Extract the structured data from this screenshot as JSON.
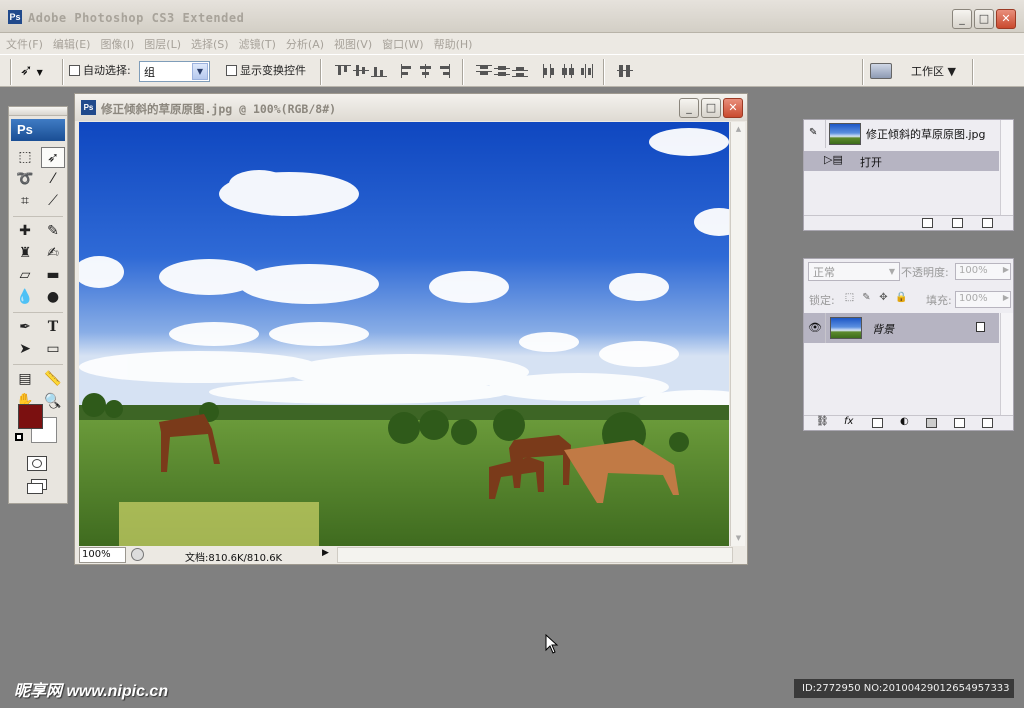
{
  "app": {
    "title": "Adobe Photoshop CS3 Extended",
    "logo": "Ps"
  },
  "menu": [
    "文件(F)",
    "编辑(E)",
    "图像(I)",
    "图层(L)",
    "选择(S)",
    "滤镜(T)",
    "分析(A)",
    "视图(V)",
    "窗口(W)",
    "帮助(H)"
  ],
  "options_bar": {
    "auto_select_label": "自动选择:",
    "auto_select_value": "组",
    "show_transform_label": "显示变换控件",
    "workspace_label": "工作区 ▼"
  },
  "toolbox": {
    "logo": "Ps",
    "foreground_color": "#7b1010",
    "background_color": "#ffffff"
  },
  "document": {
    "title": "修正倾斜的草原原图.jpg @ 100%(RGB/8#)",
    "zoom": "100%",
    "doc_info": "文档:810.6K/810.6K"
  },
  "history_panel": {
    "snapshot_label": "修正倾斜的草原原图.jpg",
    "step_label": "打开"
  },
  "layers_panel": {
    "blend_mode": "正常",
    "opacity_label": "不透明度:",
    "opacity_value": "100%",
    "lock_label": "锁定:",
    "fill_label": "填充:",
    "fill_value": "100%",
    "layer_name": "背景"
  },
  "watermark": {
    "text": "昵享网 www.nipic.cn"
  },
  "image_id": "ID:2772950 NO:20100429012654957333"
}
